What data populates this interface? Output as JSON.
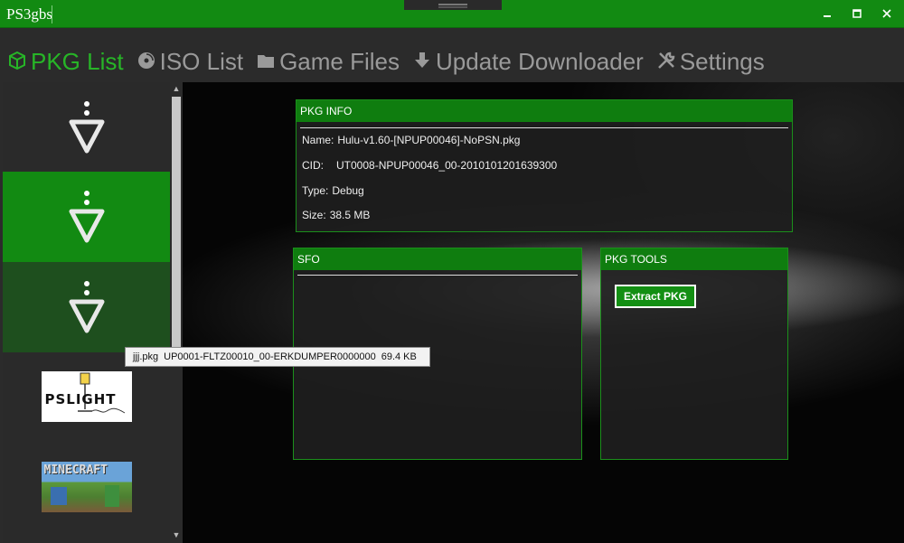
{
  "window": {
    "title": "PS3gbs"
  },
  "tabs": [
    {
      "label": "PKG List",
      "icon": "cube-icon",
      "active": true
    },
    {
      "label": "ISO List",
      "icon": "disc-icon",
      "active": false
    },
    {
      "label": "Game Files",
      "icon": "folder-icon",
      "active": false
    },
    {
      "label": "Update Downloader",
      "icon": "download-icon",
      "active": false
    },
    {
      "label": "Settings",
      "icon": "tools-icon",
      "active": false
    }
  ],
  "pkg_list": {
    "items": [
      {
        "icon": "pkg-down-arrow-icon",
        "selected": false
      },
      {
        "icon": "pkg-down-arrow-icon",
        "selected": true
      },
      {
        "icon": "pkg-down-arrow-icon",
        "selected": false,
        "hover": true
      },
      {
        "icon": "pslight-thumbnail",
        "thumb_text": "PSLIGHT",
        "selected": false
      },
      {
        "icon": "minecraft-thumbnail",
        "thumb_text": "MINECRAFT",
        "selected": false
      }
    ]
  },
  "tooltip": {
    "file": "jjj.pkg",
    "id": "UP0001-FLTZ00010_00-ERKDUMPER0000000",
    "size": "69.4 KB"
  },
  "pkg_info": {
    "header": "PKG INFO",
    "name_label": "Name:",
    "name": "Hulu-v1.60-[NPUP00046]-NoPSN.pkg",
    "cid_label": "CID:",
    "cid": "UT0008-NPUP00046_00-2010101201639300",
    "type_label": "Type:",
    "type": "Debug",
    "size_label": "Size:",
    "size": "38.5 MB"
  },
  "sfo": {
    "header": "SFO"
  },
  "pkg_tools": {
    "header": "PKG TOOLS",
    "extract_label": "Extract PKG"
  },
  "colors": {
    "accent": "#128a12",
    "active_tab": "#27b527",
    "tab_inactive": "#9a9a9a"
  }
}
